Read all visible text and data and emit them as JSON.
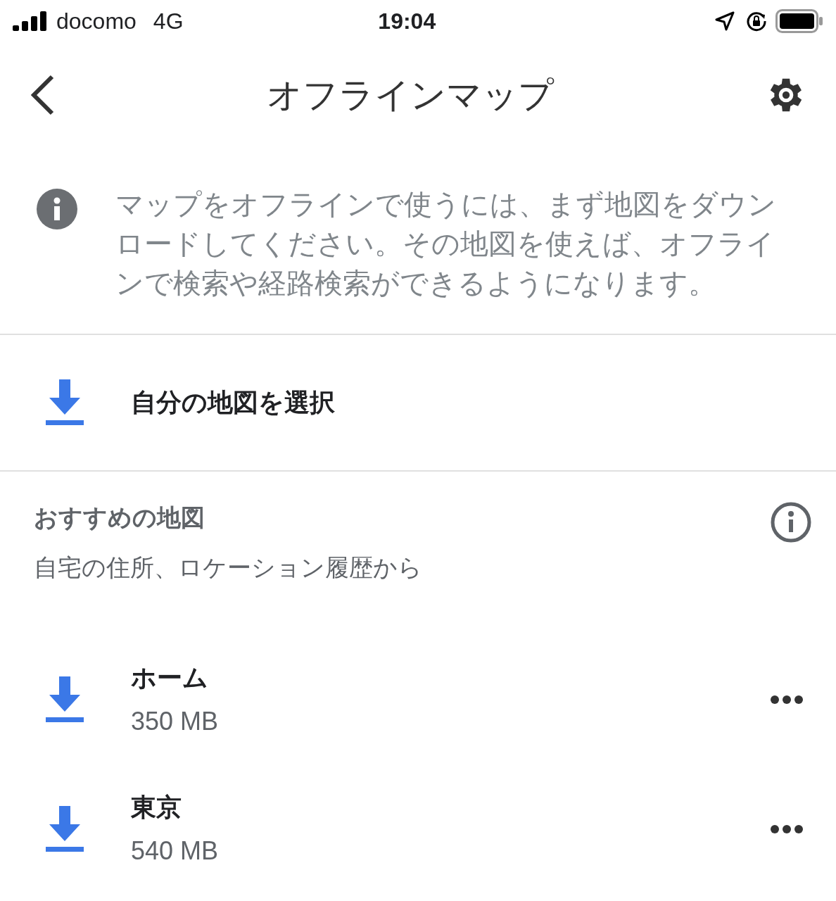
{
  "status_bar": {
    "carrier": "docomo",
    "network": "4G",
    "time": "19:04"
  },
  "header": {
    "title": "オフラインマップ"
  },
  "info": {
    "text": "マップをオフラインで使うには、まず地図をダウンロードしてください。その地図を使えば、オフラインで検索や経路検索ができるようになります。"
  },
  "select_action": {
    "label": "自分の地図を選択"
  },
  "recommended": {
    "title": "おすすめの地図",
    "subtitle": "自宅の住所、ロケーション履歴から",
    "maps": [
      {
        "name": "ホーム",
        "size": "350 MB"
      },
      {
        "name": "東京",
        "size": "540 MB"
      }
    ]
  }
}
